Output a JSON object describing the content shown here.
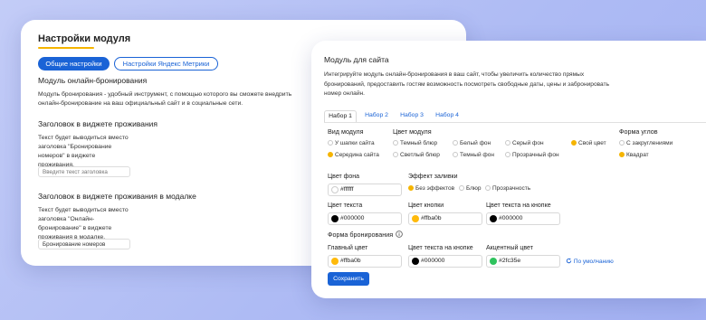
{
  "left_panel": {
    "title": "Настройки модуля",
    "tabs": [
      "Общие настройки",
      "Настройки Яндекс Метрики"
    ],
    "section_title": "Модуль онлайн-бронирования",
    "section_desc": "Модуль бронирования - удобный инструмент, с помощью которого вы сможете внедрить онлайн-бронирование на ваш официальный сайт и в социальные сети.",
    "widget_heading": "Заголовок в виджете проживания",
    "widget_desc": "Текст будет выводиться вместо заголовка \"Бронирование номеров\" в виджете проживания.",
    "widget_placeholder": "Введите текст заголовка",
    "modal_heading": "Заголовок в виджете проживания в модалке",
    "modal_desc": "Текст будет выводиться вместо заголовка \"Онлайн-бронирование\" в виджете проживания в модалке.",
    "modal_value": "Бронирование номеров"
  },
  "right_panel": {
    "title": "Модуль для сайта",
    "description": "Интегрируйте модуль онлайн-бронирования в ваш сайт, чтобы увеличить количество прямых бронирований, предоставить гостям возможность посмотреть свободные даты, цены и забронировать номер онлайн.",
    "tabs": [
      "Набор 1",
      "Набор 2",
      "Набор 3",
      "Набор 4"
    ],
    "module_view": {
      "label": "Вид модуля",
      "options": [
        "У шапки сайта",
        "Середина сайта"
      ],
      "selected": 1
    },
    "module_color": {
      "label": "Цвет модуля",
      "options": [
        "Темный блюр",
        "Белый фон",
        "Серый фон",
        "Свой цвет",
        "Светлый блюр",
        "Темный фон",
        "Прозрачный фон"
      ],
      "selected": 3
    },
    "corner_shape": {
      "label": "Форма углов",
      "options": [
        "С закруглениями",
        "Квадрат"
      ],
      "selected": 1
    },
    "bg_color": {
      "label": "Цвет фона",
      "value": "#ffffff"
    },
    "fill_effect": {
      "label": "Эффект заливки",
      "options": [
        "Без эффектов",
        "Блюр",
        "Прозрачность"
      ],
      "selected": 0
    },
    "text_color": {
      "label": "Цвет текста",
      "value": "#000000"
    },
    "button_color": {
      "label": "Цвет кнопки",
      "value": "#ffba0b"
    },
    "button_text_color": {
      "label": "Цвет текста на кнопке",
      "value": "#000000"
    },
    "booking_form": "Форма бронирования",
    "info_icon": "info-icon",
    "main_color": {
      "label": "Главный цвет",
      "value": "#ffba0b"
    },
    "button_text_color_2": {
      "label": "Цвет текста на кнопке",
      "value": "#000000"
    },
    "accent_color": {
      "label": "Акцентный цвет",
      "value": "#2fc35e"
    },
    "reset_label": "По умолчанию",
    "reset_icon": "refresh-icon",
    "save_label": "Сохранить"
  },
  "colors": {
    "accent_blue": "#1a63d6",
    "selected_radio": "#f5b400"
  }
}
